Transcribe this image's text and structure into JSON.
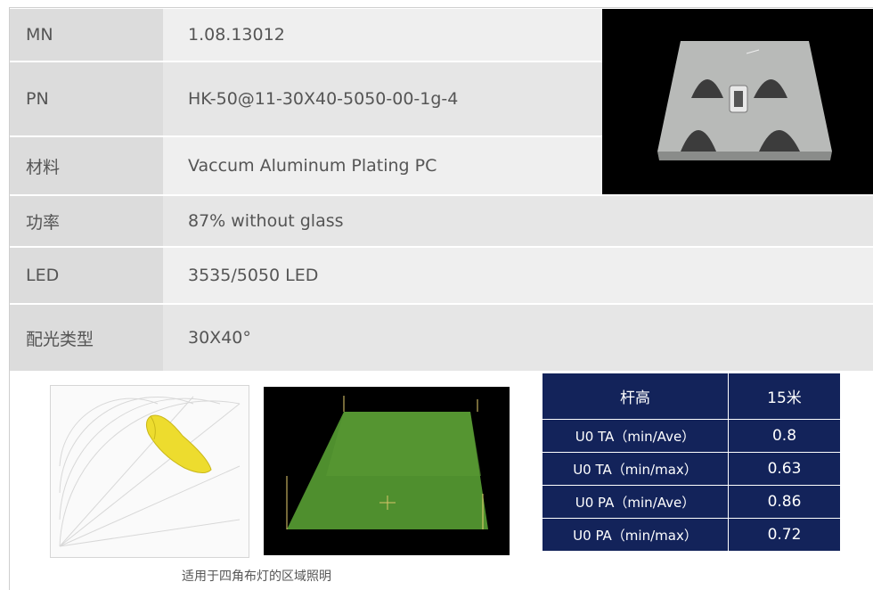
{
  "specs": [
    {
      "label": "MN",
      "value": "1.08.13012"
    },
    {
      "label": "PN",
      "value": "HK-50@11-30X40-5050-00-1g-4"
    },
    {
      "label": "材料",
      "value": "Vaccum Aluminum Plating PC"
    },
    {
      "label": "功率",
      "value": "87% without glass"
    },
    {
      "label": "LED",
      "value": "3535/5050 LED"
    },
    {
      "label": "配光类型",
      "value": "30X40°"
    }
  ],
  "caption": "适用于四角布灯的区域照明",
  "uniformity": {
    "header": {
      "key": "杆高",
      "value": "15米"
    },
    "rows": [
      {
        "key": "U0  TA（min/Ave）",
        "value": "0.8"
      },
      {
        "key": "U0  TA（min/max）",
        "value": "0.63"
      },
      {
        "key": "U0  PA（min/Ave）",
        "value": "0.86"
      },
      {
        "key": "U0  PA（min/max）",
        "value": "0.72"
      }
    ]
  },
  "colors": {
    "table_bg": "#13235a",
    "label_bg": "#dcdcdc",
    "row_bg": "#efefef",
    "lens_curve": "#f0e22a",
    "render_green": "#4c8a2c"
  },
  "images": {
    "product": "lens-module-photo",
    "polar": "polar-light-distribution-curve",
    "render": "3d-illuminance-render"
  }
}
